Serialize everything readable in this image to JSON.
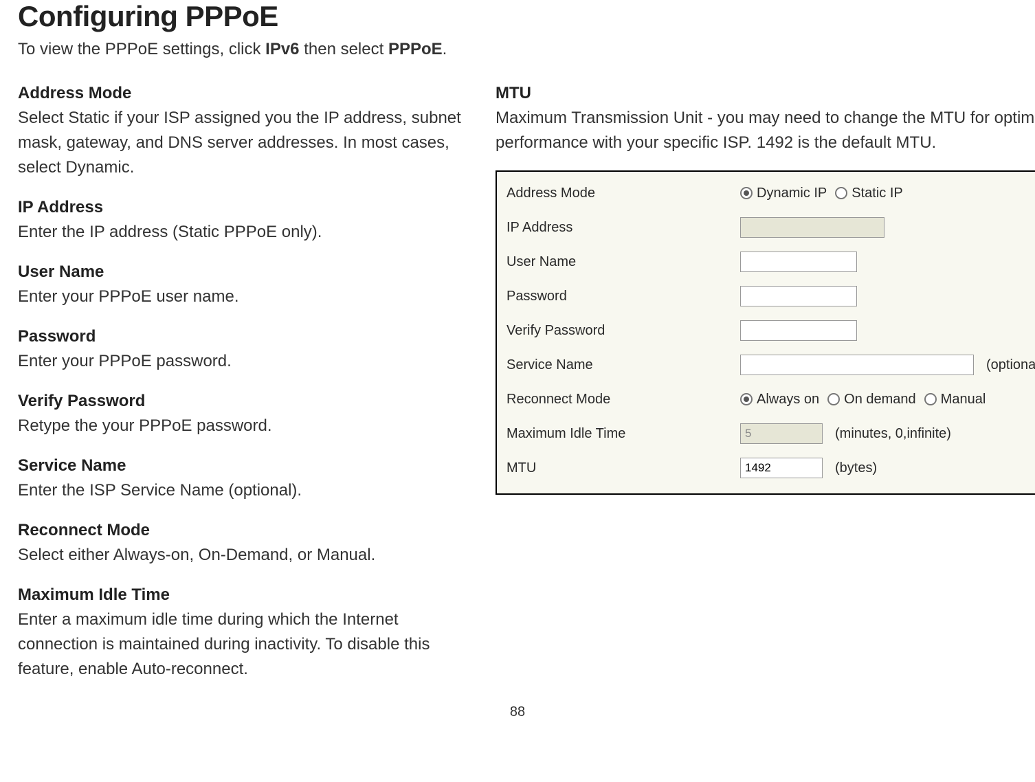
{
  "page": {
    "title": "Configuring PPPoE",
    "intro_prefix": "To view the PPPoE settings, click ",
    "intro_b1": "IPv6",
    "intro_mid": " then select ",
    "intro_b2": "PPPoE",
    "intro_suffix": ".",
    "number": "88"
  },
  "definitions": {
    "address_mode": {
      "title": "Address Mode",
      "desc": "Select Static if your ISP assigned you the IP address, subnet mask, gateway, and DNS server addresses. In most cases, select Dynamic."
    },
    "ip_address": {
      "title": "IP Address",
      "desc": "Enter the IP address (Static PPPoE only)."
    },
    "user_name": {
      "title": "User Name",
      "desc": "Enter your PPPoE user name."
    },
    "password": {
      "title": "Password",
      "desc": "Enter your PPPoE password."
    },
    "verify_password": {
      "title": "Verify Password",
      "desc": "Retype the your PPPoE password."
    },
    "service_name": {
      "title": "Service Name",
      "desc": "Enter the ISP Service Name (optional)."
    },
    "reconnect_mode": {
      "title": "Reconnect Mode",
      "desc": "Select either Always-on, On-Demand, or Manual."
    },
    "max_idle": {
      "title": "Maximum Idle Time",
      "desc": "Enter a maximum idle time during which the Internet connection is maintained during inactivity. To disable this feature, enable Auto-reconnect."
    },
    "mtu": {
      "title": "MTU",
      "desc": "Maximum Transmission Unit - you may need to change the MTU for optimal performance with your specific ISP. 1492 is the default MTU."
    }
  },
  "form": {
    "labels": {
      "address_mode": "Address Mode",
      "ip_address": "IP Address",
      "user_name": "User Name",
      "password": "Password",
      "verify_password": "Verify Password",
      "service_name": "Service Name",
      "reconnect_mode": "Reconnect Mode",
      "max_idle": "Maximum Idle Time",
      "mtu": "MTU"
    },
    "address_mode": {
      "dynamic_label": "Dynamic IP",
      "static_label": "Static IP",
      "selected": "dynamic"
    },
    "ip_address_value": "",
    "user_name_value": "",
    "password_value": "",
    "verify_password_value": "",
    "service_name_value": "",
    "service_name_suffix": "(optional)",
    "reconnect_mode": {
      "always_label": "Always on",
      "ondemand_label": "On demand",
      "manual_label": "Manual",
      "selected": "always"
    },
    "max_idle_value": "5",
    "max_idle_suffix": "(minutes, 0,infinite)",
    "mtu_value": "1492",
    "mtu_suffix": "(bytes)"
  }
}
